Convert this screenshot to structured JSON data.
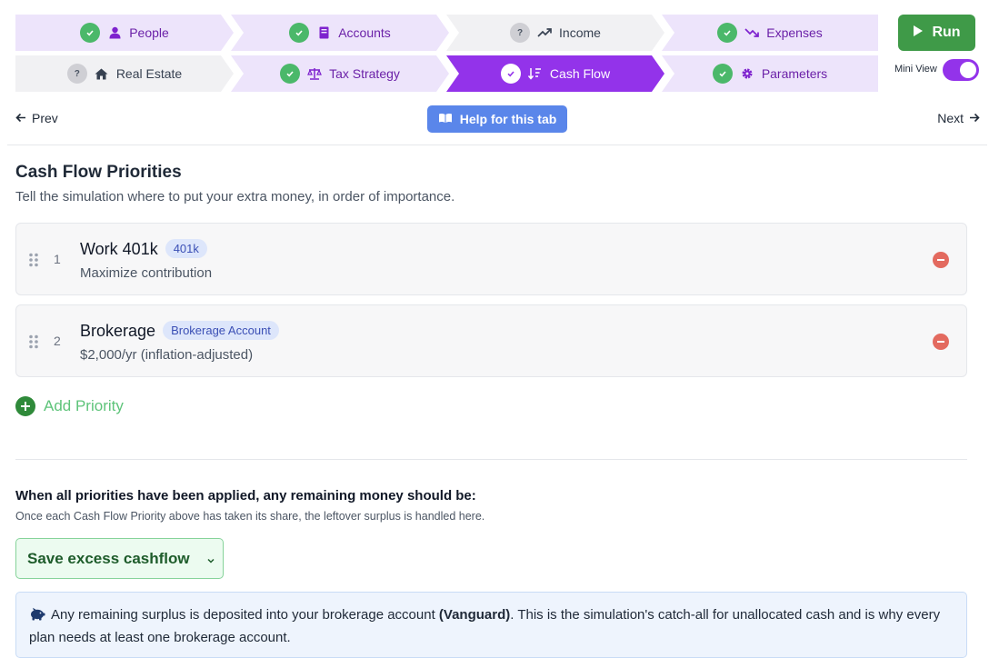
{
  "steps_row1": [
    {
      "label": "People",
      "status": "done",
      "icon": "user-icon"
    },
    {
      "label": "Accounts",
      "status": "done",
      "icon": "book-icon"
    },
    {
      "label": "Income",
      "status": "pending",
      "icon": "trend-up-icon"
    },
    {
      "label": "Expenses",
      "status": "done",
      "icon": "trend-down-icon"
    }
  ],
  "steps_row2": [
    {
      "label": "Real Estate",
      "status": "pending",
      "icon": "home-icon"
    },
    {
      "label": "Tax Strategy",
      "status": "done",
      "icon": "scale-icon"
    },
    {
      "label": "Cash Flow",
      "status": "active",
      "icon": "sort-icon"
    },
    {
      "label": "Parameters",
      "status": "done",
      "icon": "gear-icon"
    }
  ],
  "status_badges": {
    "pending": "?"
  },
  "run_label": "Run",
  "mini_view_label": "Mini View",
  "mini_view_on": true,
  "nav": {
    "prev": "Prev",
    "next": "Next",
    "help": "Help for this tab"
  },
  "section": {
    "title": "Cash Flow Priorities",
    "subtitle": "Tell the simulation where to put your extra money, in order of importance."
  },
  "priorities": [
    {
      "num": "1",
      "name": "Work 401k",
      "tag": "401k",
      "desc": "Maximize contribution"
    },
    {
      "num": "2",
      "name": "Brokerage",
      "tag": "Brokerage Account",
      "desc": "$2,000/yr (inflation-adjusted)"
    }
  ],
  "add_priority_label": "Add Priority",
  "remaining": {
    "title": "When all priorities have been applied, any remaining money should be:",
    "subtitle": "Once each Cash Flow Priority above has taken its share, the leftover surplus is handled here.",
    "selected": "Save excess cashflow"
  },
  "info": {
    "text_before": "Any remaining surplus is deposited into your brokerage account ",
    "account": "(Vanguard)",
    "text_after": ". This is the simulation's catch-all for unallocated cash and is why every plan needs at least one brokerage account."
  },
  "colors": {
    "accent": "#9333ea",
    "done": "#ede4fb",
    "run": "#3f9a48",
    "help": "#5a86ea"
  }
}
